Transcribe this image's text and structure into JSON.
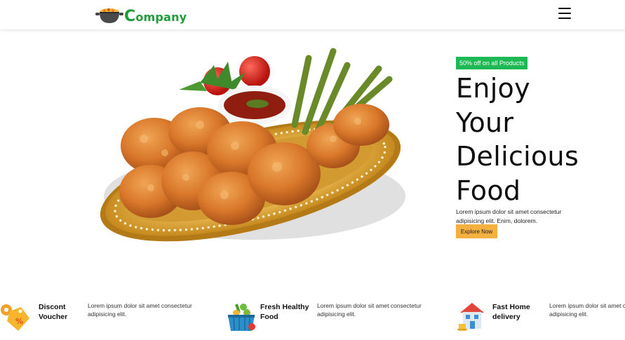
{
  "header": {
    "logo_letter": "C",
    "logo_rest": "ompany",
    "menu_icon": "hamburger-menu-icon"
  },
  "hero": {
    "image_icon": "fried-chicken-plate-image",
    "badge": "50% off on all Products",
    "title_lines": [
      "Enjoy",
      "Your",
      "Delicious",
      "Food"
    ],
    "description": "Lorem ipsum dolor sit amet consectetur adipisicing elit. Enim, dolorem.",
    "cta_label": "Explore Now"
  },
  "features": [
    {
      "icon": "discount-tag-icon",
      "title": "Discont Voucher",
      "description": "Lorem ipsum dolor sit amet consectetur adipisicing elit."
    },
    {
      "icon": "vegetable-basket-icon",
      "title": "Fresh Healthy Food",
      "description": "Lorem ipsum dolor sit amet consectetur adipisicing elit."
    },
    {
      "icon": "home-delivery-icon",
      "title": "Fast Home delivery",
      "description": "Lorem ipsum dolor sit amet consectetur adipisicing elit."
    }
  ],
  "colors": {
    "brand_green": "#1f9d3a",
    "badge_green": "#1db954",
    "cta_orange": "#f4b13f"
  }
}
